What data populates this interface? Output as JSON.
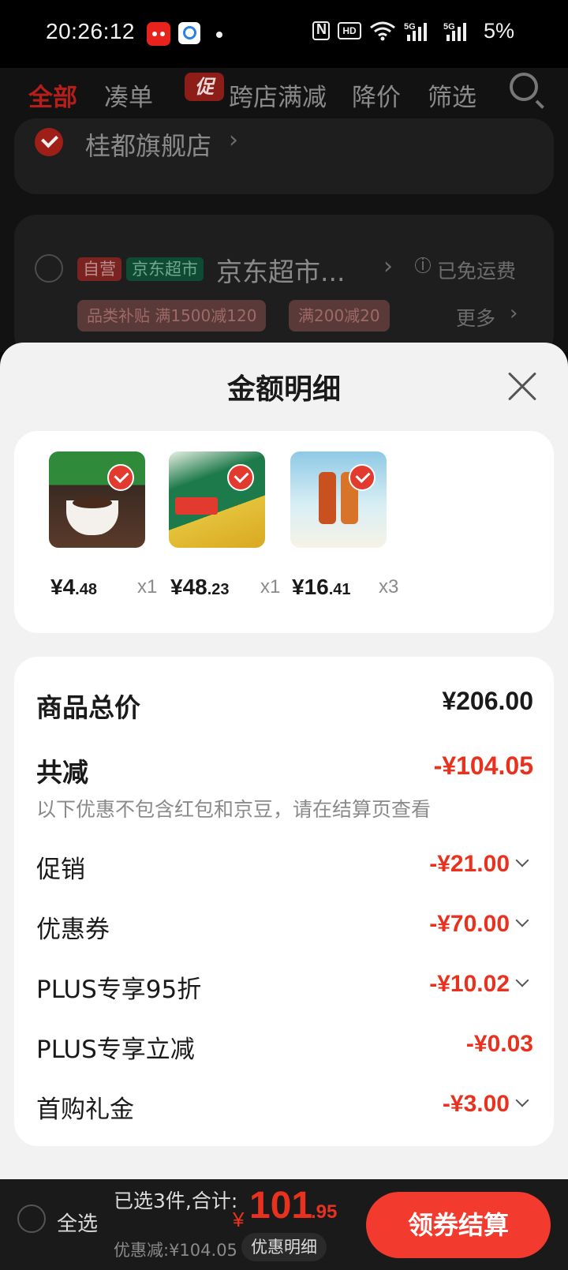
{
  "status_bar": {
    "time": "20:26:12",
    "network": "5G",
    "battery": "5%",
    "icons": [
      "tmall-app-icon",
      "search-app-icon",
      "nfc-icon",
      "hd-icon",
      "wifi-icon",
      "signal-icon"
    ]
  },
  "tabs": [
    {
      "label": "全部",
      "active": true
    },
    {
      "label": "凑单",
      "active": false
    },
    {
      "label": "跨店满减",
      "badge": "促",
      "active": false
    },
    {
      "label": "降价",
      "active": false
    },
    {
      "label": "筛选",
      "active": false
    }
  ],
  "stores": [
    {
      "name": "桂都旗舰店",
      "selected": true
    },
    {
      "name": "京东超市...",
      "selected": false,
      "tags": [
        "自营",
        "京东超市"
      ],
      "shipping": "已免运费",
      "coupons": [
        "品类补贴 满1500减120",
        "满200减20"
      ],
      "more_label": "更多"
    }
  ],
  "sheet": {
    "title": "金额明细",
    "items": [
      {
        "price_int": "¥4",
        "price_dec": ".48",
        "qty": "x1",
        "color": "#2f8a3a"
      },
      {
        "price_int": "¥48",
        "price_dec": ".23",
        "qty": "x1",
        "color": "#1d7a4a"
      },
      {
        "price_int": "¥16",
        "price_dec": ".41",
        "qty": "x3",
        "color": "#8ec9e6"
      }
    ],
    "total_label": "商品总价",
    "total_value": "¥206.00",
    "reduce_label": "共减",
    "reduce_value": "-¥104.05",
    "note": "以下优惠不包含红包和京豆，请在结算页查看",
    "rows": [
      {
        "label": "促销",
        "value": "-¥21.00",
        "expandable": true
      },
      {
        "label": "优惠券",
        "value": "-¥70.00",
        "expandable": true
      },
      {
        "label": "PLUS专享95折",
        "value": "-¥10.02",
        "expandable": true
      },
      {
        "label": "PLUS专享立减",
        "value": "-¥0.03",
        "expandable": false
      },
      {
        "label": "首购礼金",
        "value": "-¥3.00",
        "expandable": true
      }
    ]
  },
  "bottom_bar": {
    "select_all": "全选",
    "summary": "已选3件,合计:",
    "total_currency": "¥",
    "total_int": "101",
    "total_dec": ".95",
    "discount": "优惠减:¥104.05",
    "detail_button": "优惠明细",
    "checkout_button": "领券结算"
  },
  "colors": {
    "accent_red": "#e8321f",
    "checkout_red": "#f23b2e"
  }
}
